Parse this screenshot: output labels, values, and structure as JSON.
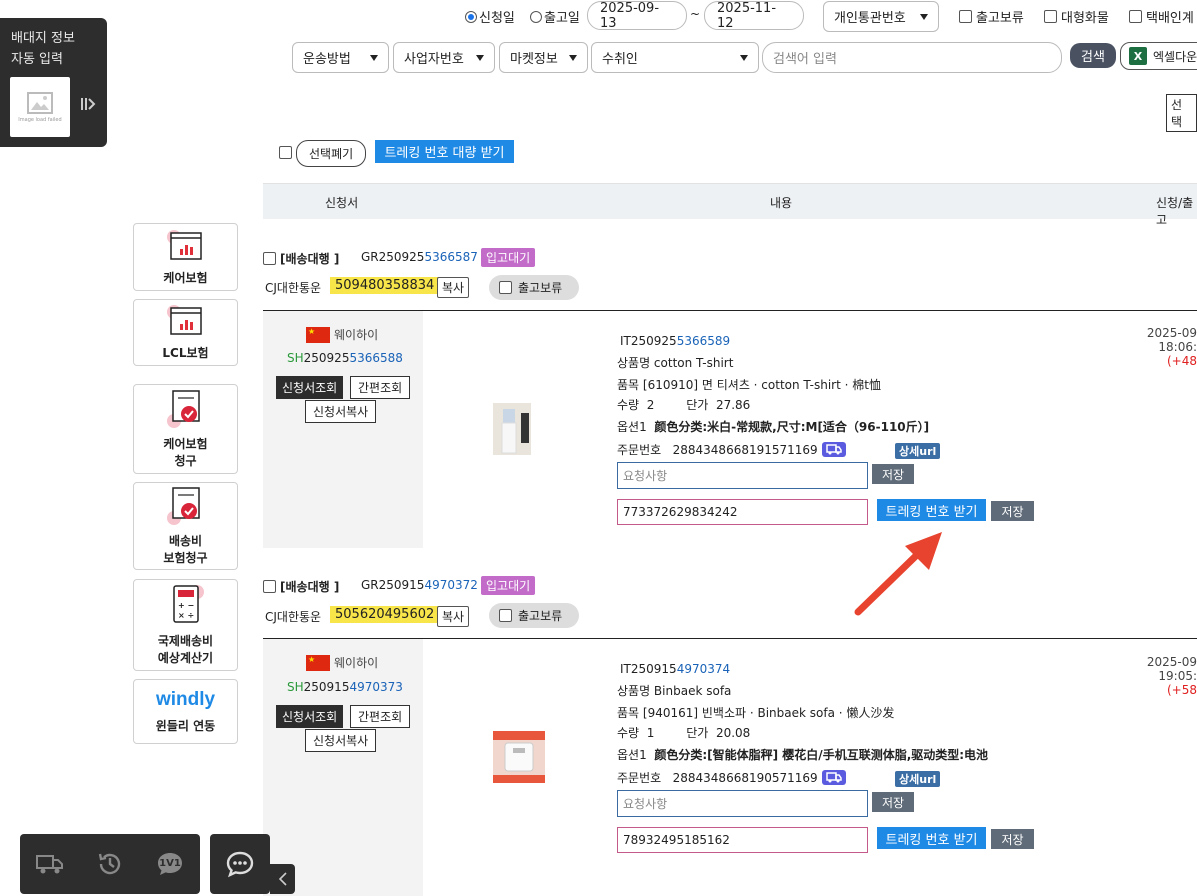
{
  "filters": {
    "radio_apply_date": "신청일",
    "radio_ship_date": "출고일",
    "date_from": "2025-09-13",
    "date_tilde": "~",
    "date_to": "2025-11-12",
    "customs_select": "개인통관번호",
    "cb_hold": "출고보류",
    "cb_bulk": "대형화물",
    "cb_delivery": "택배인계",
    "shipping_method": "운송방법",
    "business_no": "사업자번호",
    "market_info": "마켓정보",
    "recipient": "수취인",
    "search_placeholder": "검색어 입력",
    "search_button": "검색",
    "excel_button": "엑셀다운",
    "select_button": "선택"
  },
  "auto_panel": {
    "line1": "배대지 정보",
    "line2": "자동 입력",
    "image_failed": "Image load failed"
  },
  "actions": {
    "discard_selected": "선택폐기",
    "bulk_tracking": "트레킹 번호 대량 받기"
  },
  "table": {
    "col_application": "신청서",
    "col_content": "내용",
    "col_date": "신청/출고"
  },
  "side_menu": [
    {
      "label": "케어보험"
    },
    {
      "label": "LCL보험"
    },
    {
      "label_line1": "케어보험",
      "label_line2": "청구"
    },
    {
      "label_line1": "배송비",
      "label_line2": "보험청구"
    },
    {
      "label_line1": "국제배송비",
      "label_line2": "예상계산기"
    },
    {
      "logo": "windly",
      "label": "윈들리 연동"
    }
  ],
  "orders": [
    {
      "service": "[배송대행 ]",
      "gr_prefix": "GR250925",
      "gr_suffix": "5366587",
      "status": "입고대기",
      "carrier": "CJ대한통운",
      "tracking": "509480358834",
      "copy": "복사",
      "hold": "출고보류",
      "origin": "웨이하이",
      "sh_prefix": "SH",
      "sh_mid": "250925",
      "sh_suffix": "5366588",
      "btn_view": "신청서조회",
      "btn_quick": "간편조회",
      "btn_copy_app": "신청서복사",
      "it_prefix": "IT250925",
      "it_suffix": "5366589",
      "product_name": "상품명 cotton T-shirt",
      "item": "품목  [610910] 면 티셔츠 · cotton T-shirt · 棉t恤",
      "qty_label": "수량",
      "qty": "2",
      "price_label": "단가",
      "price": "27.86",
      "option_label": "옵션1",
      "option": "颜色分类:米白-常规款,尺寸:M[适合（96-110斤）]",
      "order_no_label": "주문번호",
      "order_no": "2884348668191571169",
      "detail_url": "상세url",
      "memo_placeholder": "요청사항",
      "save": "저장",
      "tracking_input": "773372629834242",
      "get_tracking": "트레킹 번호 받기",
      "date": "2025-09",
      "time": "18:06:",
      "days": "(+48"
    },
    {
      "service": "[배송대행 ]",
      "gr_prefix": "GR250915",
      "gr_suffix": "4970372",
      "status": "입고대기",
      "carrier": "CJ대한통운",
      "tracking": "505620495602",
      "copy": "복사",
      "hold": "출고보류",
      "origin": "웨이하이",
      "sh_prefix": "SH",
      "sh_mid": "250915",
      "sh_suffix": "4970373",
      "btn_view": "신청서조회",
      "btn_quick": "간편조회",
      "btn_copy_app": "신청서복사",
      "it_prefix": "IT250915",
      "it_suffix": "4970374",
      "product_name": "상품명 Binbaek sofa",
      "item": "품목  [940161] 빈백소파 · Binbaek sofa · 懒人沙发",
      "qty_label": "수량",
      "qty": "1",
      "price_label": "단가",
      "price": "20.08",
      "option_label": "옵션1",
      "option": "颜色分类:[智能体脂秤] 樱花白/手机互联测体脂,驱动类型:电池",
      "order_no_label": "주문번호",
      "order_no": "2884348668190571169",
      "detail_url": "상세url",
      "memo_placeholder": "요청사항",
      "save": "저장",
      "tracking_input": "78932495185162",
      "get_tracking": "트레킹 번호 받기",
      "date": "2025-09",
      "time": "19:05:",
      "days": "(+58"
    }
  ],
  "bottom_toolbar": {
    "oneonone": "1V1"
  },
  "colors": {
    "accent_blue": "#1f8ae5",
    "status_purple": "#c26bc9",
    "tracking_yellow": "#f7e54a",
    "arrow_red": "#e8432e"
  }
}
